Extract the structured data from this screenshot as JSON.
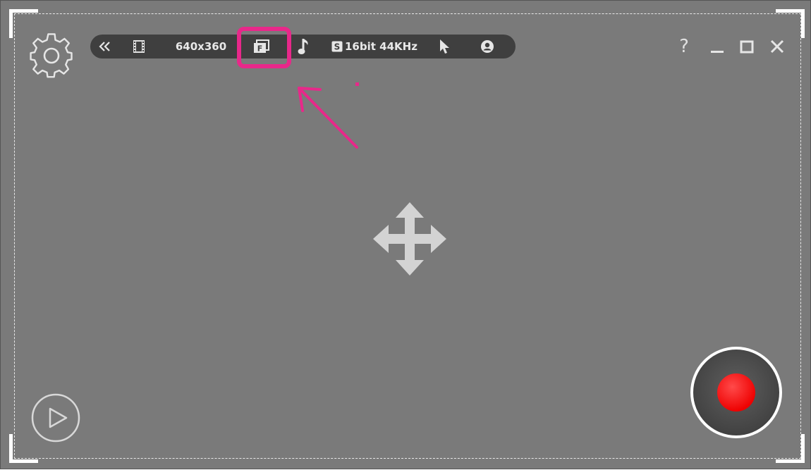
{
  "toolbar": {
    "resolution": "640x360",
    "audio_format": "16bit 44KHz"
  },
  "window_controls": {
    "help": "?"
  },
  "icons": {
    "settings": "gear-icon",
    "collapse": "double-chevron-left-icon",
    "video": "film-icon",
    "fullscreen_region": "f-window-icon",
    "audio": "music-note-icon",
    "audio_source": "s-badge-icon",
    "cursor": "cursor-arrow-icon",
    "webcam": "webcam-icon",
    "minimize": "minimize-icon",
    "maximize": "maximize-icon",
    "close": "close-icon",
    "move": "move-arrows-icon",
    "play": "play-icon",
    "record": "record-icon"
  },
  "colors": {
    "background": "#7a7a7a",
    "toolbar": "#3f3f3f",
    "highlight": "#e8288a",
    "record_dot": "#ff0000"
  }
}
